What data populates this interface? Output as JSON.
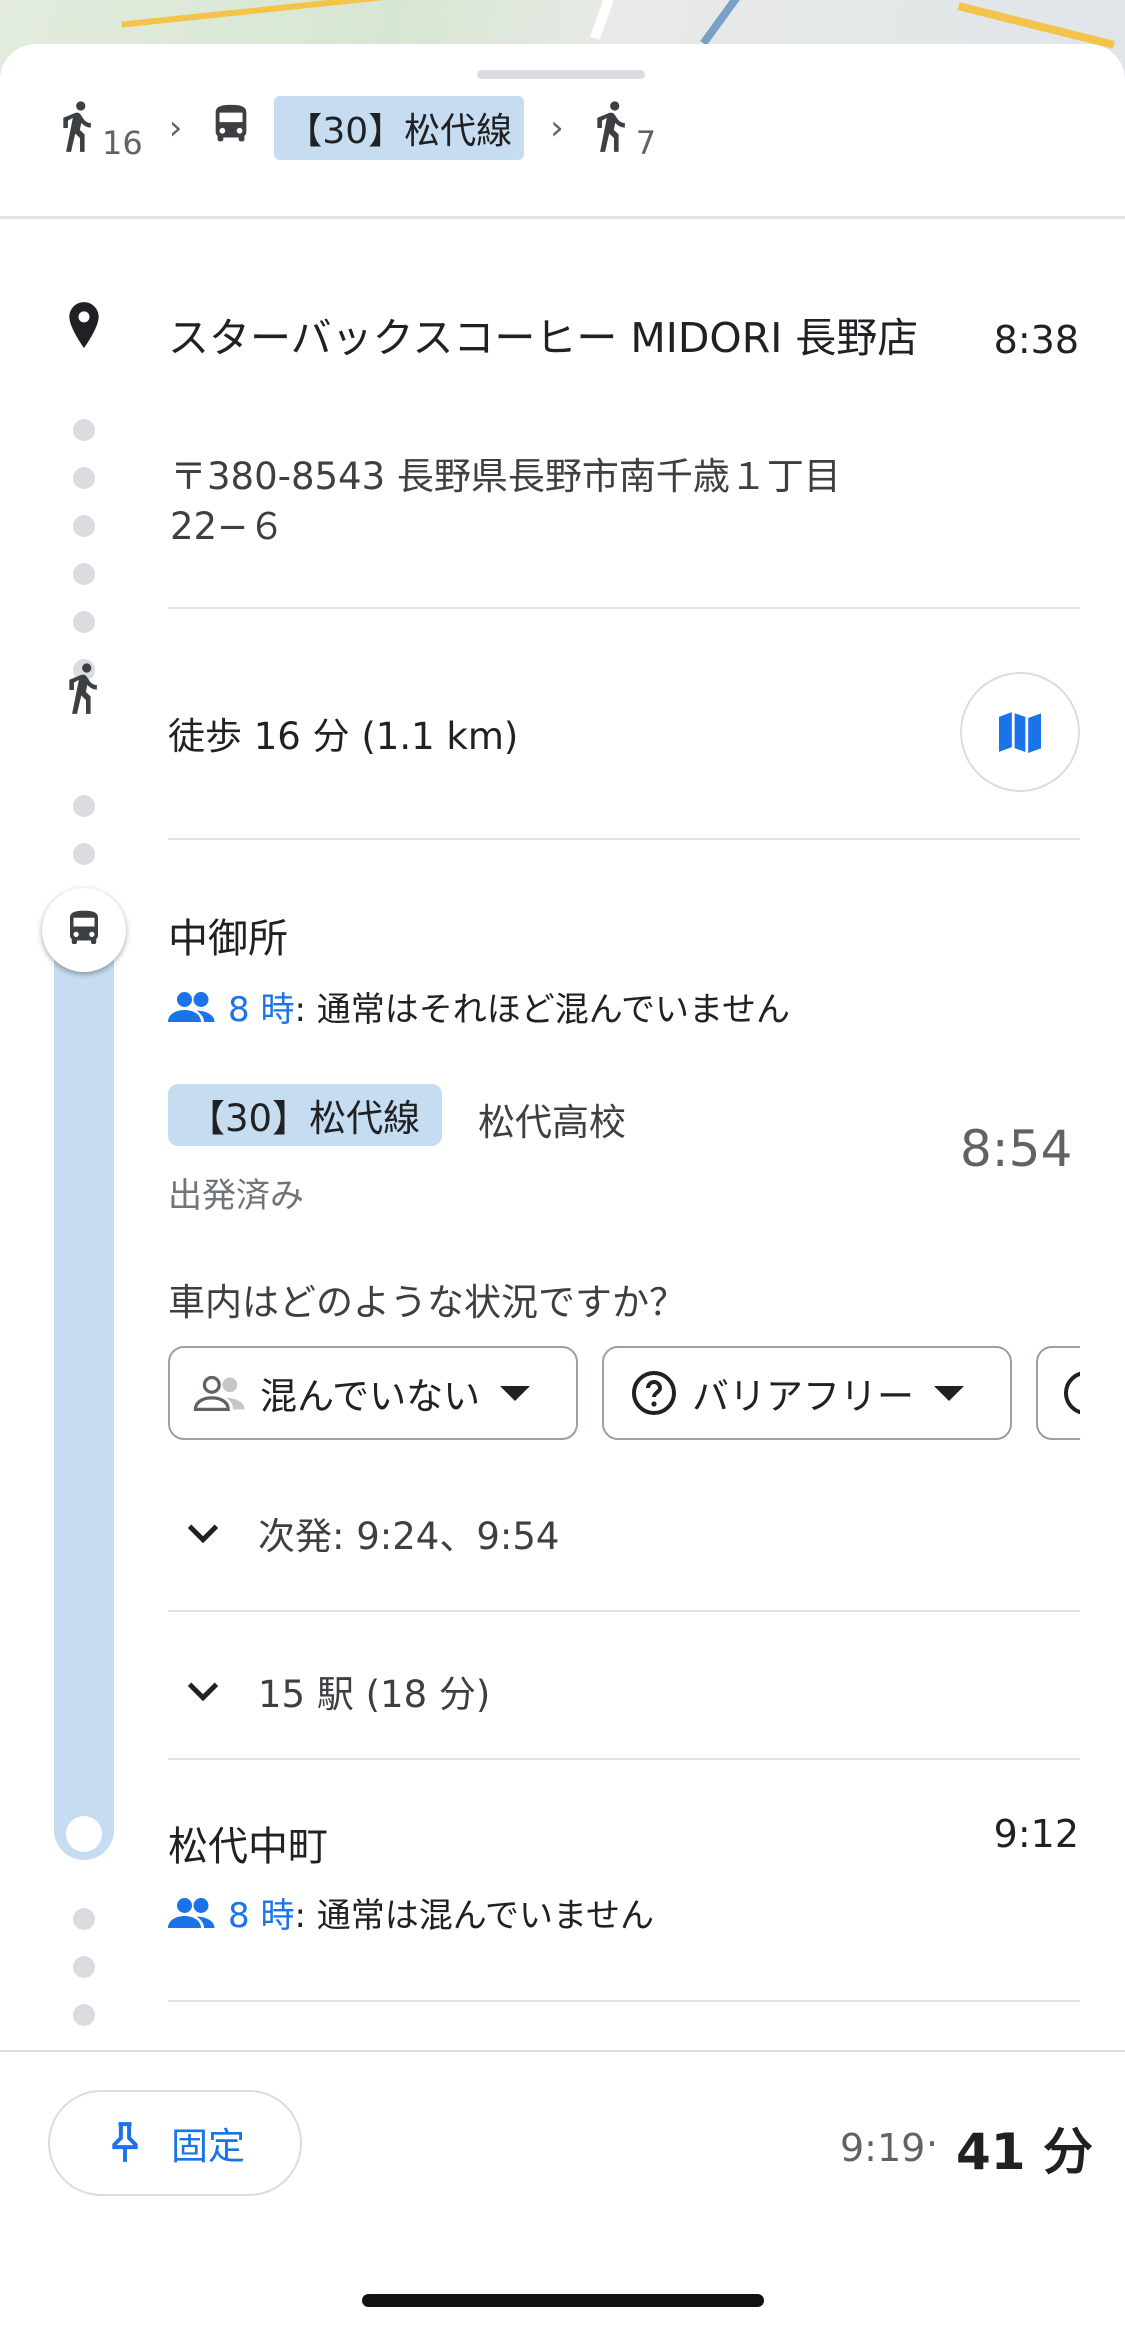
{
  "route_summary": {
    "walk_start_minutes": "16",
    "line_label": "【30】松代線",
    "walk_end_minutes": "7",
    "chevron": "›"
  },
  "origin": {
    "name": "スターバックスコーヒー MIDORI 長野店",
    "time": "8:38",
    "address": "〒380-8543 長野県長野市南千歳１丁目22−６"
  },
  "walk": {
    "text": "徒歩 16 分 (1.1 km)"
  },
  "boarding": {
    "stop_name": "中御所",
    "crowd_hour": "8 時",
    "crowd_text": ": 通常はそれほど混んでいません",
    "line_label": "【30】松代線",
    "destination": "松代高校",
    "status": "出発済み",
    "departure_time": "8:54",
    "question": "車内はどのような状況ですか？",
    "feedback_chips": [
      {
        "label": "混んでいない"
      },
      {
        "label": "バリアフリー"
      }
    ],
    "next_departures": "次発: 9:24、9:54",
    "stops_summary": "15 駅 (18 分)"
  },
  "alighting": {
    "stop_name": "松代中町",
    "time": "9:12",
    "crowd_hour": "8 時",
    "crowd_text": ": 通常は混んでいません"
  },
  "bottom_bar": {
    "pin_label": "固定",
    "arrival_time": "9:19",
    "separator": "·",
    "total_duration": "41 分"
  },
  "colors": {
    "accent_blue": "#1a73e8",
    "transit_line": "#c6dcf0",
    "text_primary": "#202124",
    "text_secondary": "#5f6368"
  }
}
